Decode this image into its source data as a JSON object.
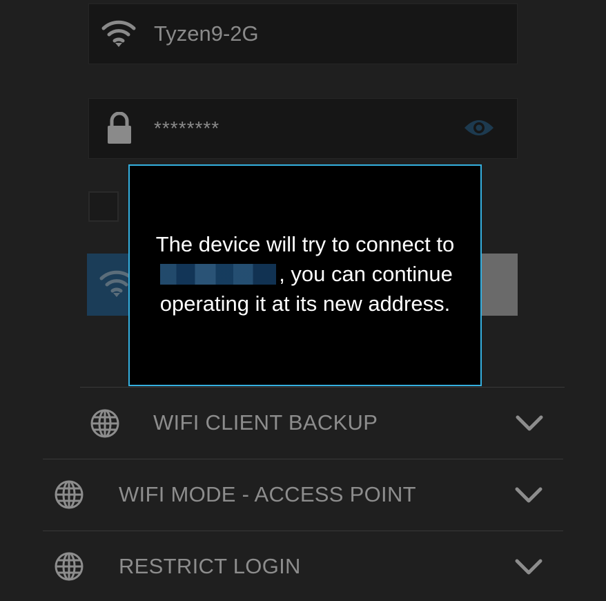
{
  "wifi_form": {
    "ssid_value": "Tyzen9-2G",
    "password_value": "********"
  },
  "dialog": {
    "message_before": "The device will try to connect to",
    "redacted_ssid": "",
    "message_after": ", you can continue operating it at its new address."
  },
  "sections": [
    {
      "label": "WIFI CLIENT BACKUP",
      "icon": "globe-icon",
      "expand_icon": "chevron-down-icon"
    },
    {
      "label": "WIFI MODE - ACCESS POINT",
      "icon": "globe-icon",
      "expand_icon": "chevron-down-icon"
    },
    {
      "label": "RESTRICT LOGIN",
      "icon": "globe-icon",
      "expand_icon": "chevron-down-icon"
    }
  ],
  "colors": {
    "background": "#1f1f1f",
    "dialog_border": "#35b0e0",
    "connect_button": "#1b3d58",
    "muted_text": "#8d8d8d"
  }
}
